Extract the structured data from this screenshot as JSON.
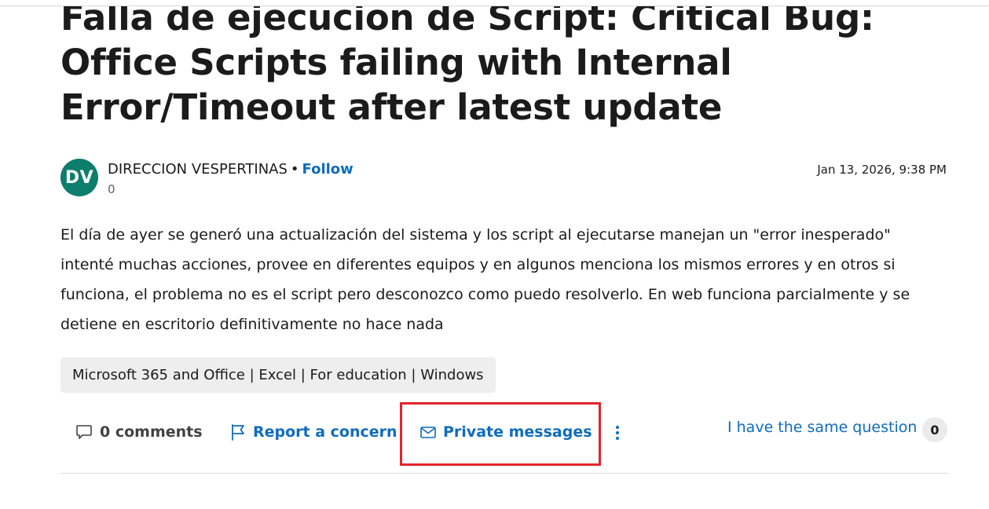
{
  "post": {
    "title": "Falla de ejecucion de Script: Critical Bug: Office Scripts failing with Internal Error/Timeout after latest update",
    "author": {
      "initials": "DV",
      "name": "DIRECCION VESPERTINAS",
      "separator": "•",
      "follow_label": "Follow",
      "reputation": "0"
    },
    "timestamp": "Jan 13, 2026, 9:38 PM",
    "body": "El día de ayer se generó una actualización del sistema y los script al ejecutarse manejan un \"error inesperado\" intenté muchas acciones, provee en diferentes equipos y en algunos menciona los mismos errores y en otros si funciona, el problema no es el script pero desconozco como puedo resolverlo. En web funciona parcialmente y se detiene en escritorio definitivamente no hace nada",
    "tags": "Microsoft 365 and Office | Excel | For education | Windows"
  },
  "actions": {
    "comments_label": "0 comments",
    "report_label": "Report a concern",
    "private_messages_label": "Private messages",
    "same_question_label": "I have the same question",
    "same_question_count": "0"
  },
  "icons": {
    "comments": "comment-icon",
    "report": "flag-icon",
    "private_messages": "mail-icon",
    "more": "more-vertical-icon"
  },
  "colors": {
    "link": "#0f6cbd",
    "avatar_bg": "#0d7d6c",
    "highlight": "#e3242b"
  }
}
